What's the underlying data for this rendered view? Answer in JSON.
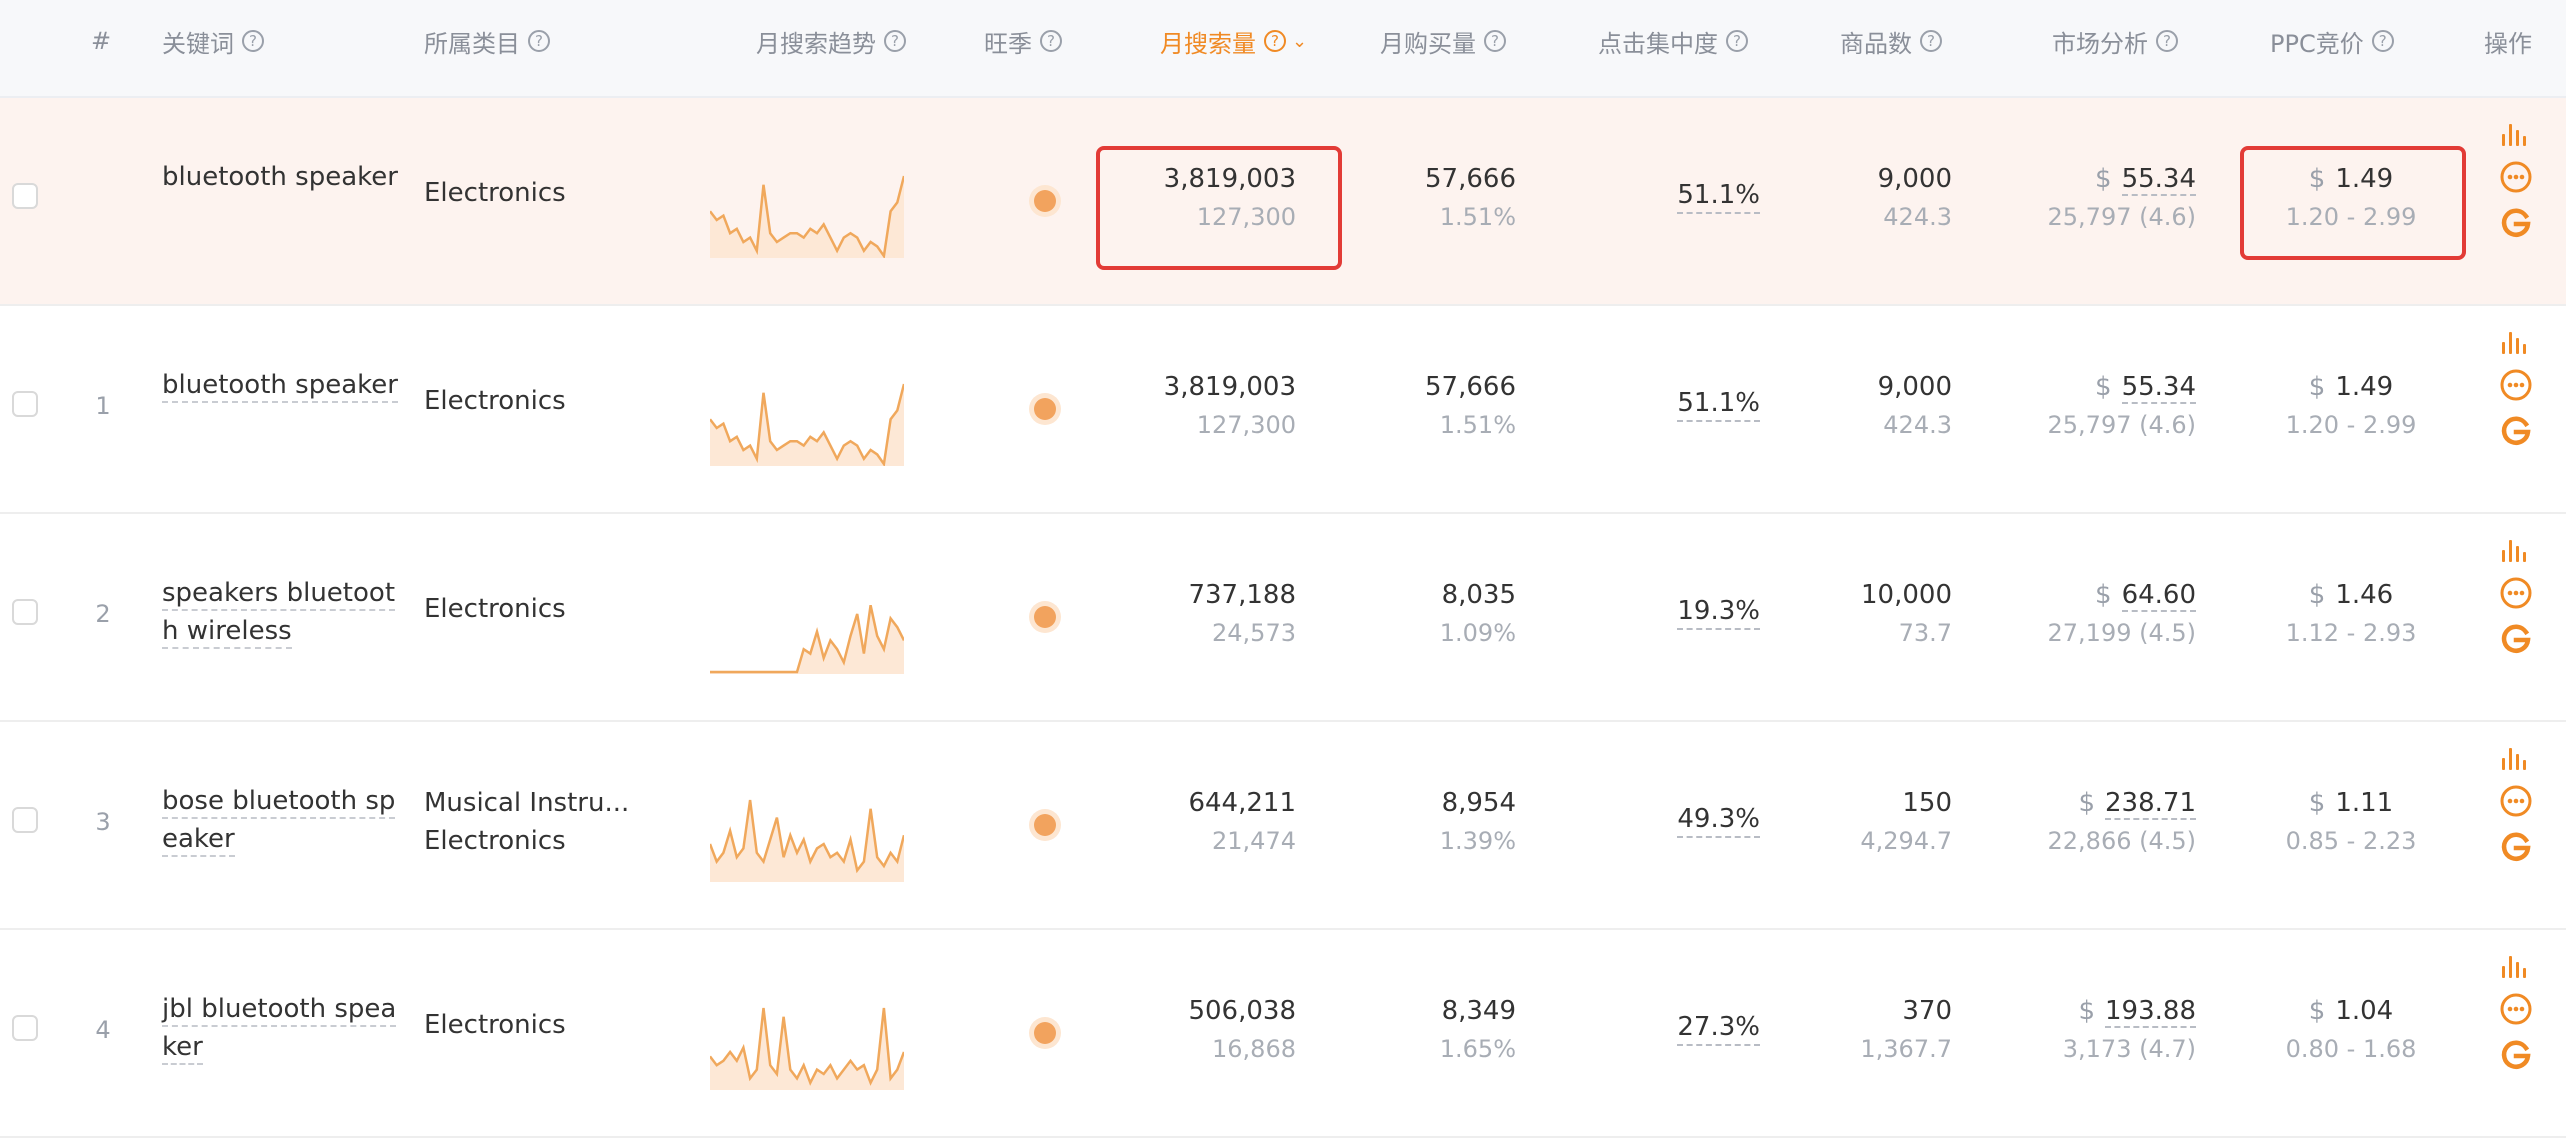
{
  "header": {
    "index": "#",
    "keyword": "关键词",
    "category": "所属类目",
    "trend": "月搜索趋势",
    "season": "旺季",
    "monthly_search": "月搜索量",
    "monthly_purchase": "月购买量",
    "click_concentration": "点击集中度",
    "product_count": "商品数",
    "market_analysis": "市场分析",
    "ppc_bid": "PPC竞价",
    "actions": "操作",
    "help_icon_glyph": "?",
    "sort_caret": "⌄"
  },
  "colors": {
    "accent": "#f08a24",
    "highlight_row": "#fdf3ef",
    "red_box": "#e23b36"
  },
  "rows": [
    {
      "index": "",
      "keyword": "bluetooth speaker",
      "categories": [
        "Electronics"
      ],
      "trend": [
        0.6,
        0.5,
        0.55,
        0.35,
        0.4,
        0.25,
        0.3,
        0.15,
        0.9,
        0.35,
        0.25,
        0.3,
        0.35,
        0.35,
        0.3,
        0.4,
        0.35,
        0.45,
        0.3,
        0.15,
        0.3,
        0.35,
        0.3,
        0.15,
        0.25,
        0.2,
        0.05,
        0.6,
        0.7,
        1.0
      ],
      "season_marker": "peak",
      "monthly_search": "3,819,003",
      "daily_search": "127,300",
      "monthly_purchase": "57,666",
      "purchase_rate": "1.51%",
      "click_concentration": "51.1%",
      "product_count": "9,000",
      "product_ratio": "424.3",
      "currency": "$",
      "market_price": "55.34",
      "market_reviews": "25,797 (4.6)",
      "ppc_bid": "1.49",
      "ppc_range": "1.20 - 2.99",
      "highlighted": true
    },
    {
      "index": "1",
      "keyword": "bluetooth speaker",
      "categories": [
        "Electronics"
      ],
      "trend": [
        0.6,
        0.5,
        0.55,
        0.35,
        0.4,
        0.25,
        0.3,
        0.15,
        0.9,
        0.35,
        0.25,
        0.3,
        0.35,
        0.35,
        0.3,
        0.4,
        0.35,
        0.45,
        0.3,
        0.15,
        0.3,
        0.35,
        0.3,
        0.15,
        0.25,
        0.2,
        0.05,
        0.6,
        0.7,
        1.0
      ],
      "season_marker": "peak",
      "monthly_search": "3,819,003",
      "daily_search": "127,300",
      "monthly_purchase": "57,666",
      "purchase_rate": "1.51%",
      "click_concentration": "51.1%",
      "product_count": "9,000",
      "product_ratio": "424.3",
      "currency": "$",
      "market_price": "55.34",
      "market_reviews": "25,797 (4.6)",
      "ppc_bid": "1.49",
      "ppc_range": "1.20 - 2.99",
      "highlighted": false
    },
    {
      "index": "2",
      "keyword": "speakers bluetooth wireless",
      "categories": [
        "Electronics"
      ],
      "trend": [
        0.0,
        0.0,
        0.0,
        0.0,
        0.0,
        0.0,
        0.0,
        0.0,
        0.0,
        0.0,
        0.0,
        0.0,
        0.02,
        0.05,
        0.35,
        0.3,
        0.55,
        0.25,
        0.45,
        0.35,
        0.2,
        0.5,
        0.75,
        0.3,
        0.85,
        0.5,
        0.35,
        0.7,
        0.6,
        0.45
      ],
      "season_marker": "peak",
      "monthly_search": "737,188",
      "daily_search": "24,573",
      "monthly_purchase": "8,035",
      "purchase_rate": "1.09%",
      "click_concentration": "19.3%",
      "product_count": "10,000",
      "product_ratio": "73.7",
      "currency": "$",
      "market_price": "64.60",
      "market_reviews": "27,199 (4.5)",
      "ppc_bid": "1.46",
      "ppc_range": "1.12 - 2.93",
      "highlighted": false
    },
    {
      "index": "3",
      "keyword": "bose bluetooth speaker",
      "categories": [
        "Musical Instru...",
        "Electronics"
      ],
      "trend": [
        0.5,
        0.3,
        0.4,
        0.65,
        0.35,
        0.45,
        1.0,
        0.4,
        0.3,
        0.55,
        0.8,
        0.35,
        0.6,
        0.4,
        0.55,
        0.3,
        0.45,
        0.5,
        0.35,
        0.4,
        0.3,
        0.55,
        0.2,
        0.3,
        0.9,
        0.35,
        0.25,
        0.4,
        0.3,
        0.6
      ],
      "season_marker": "peak",
      "monthly_search": "644,211",
      "daily_search": "21,474",
      "monthly_purchase": "8,954",
      "purchase_rate": "1.39%",
      "click_concentration": "49.3%",
      "product_count": "150",
      "product_ratio": "4,294.7",
      "currency": "$",
      "market_price": "238.71",
      "market_reviews": "22,866 (4.5)",
      "ppc_bid": "1.11",
      "ppc_range": "0.85 - 2.23",
      "highlighted": false
    },
    {
      "index": "4",
      "keyword": "jbl bluetooth speaker",
      "categories": [
        "Electronics"
      ],
      "trend": [
        0.45,
        0.35,
        0.4,
        0.5,
        0.4,
        0.55,
        0.2,
        0.3,
        1.0,
        0.35,
        0.25,
        0.9,
        0.3,
        0.2,
        0.35,
        0.15,
        0.3,
        0.25,
        0.35,
        0.2,
        0.3,
        0.4,
        0.3,
        0.35,
        0.15,
        0.3,
        1.0,
        0.2,
        0.3,
        0.5
      ],
      "season_marker": "peak",
      "monthly_search": "506,038",
      "daily_search": "16,868",
      "monthly_purchase": "8,349",
      "purchase_rate": "1.65%",
      "click_concentration": "27.3%",
      "product_count": "370",
      "product_ratio": "1,367.7",
      "currency": "$",
      "market_price": "193.88",
      "market_reviews": "3,173 (4.7)",
      "ppc_bid": "1.04",
      "ppc_range": "0.80 - 1.68",
      "highlighted": false
    }
  ],
  "row_actions": [
    "bar-chart-icon",
    "more-icon",
    "google-icon"
  ]
}
